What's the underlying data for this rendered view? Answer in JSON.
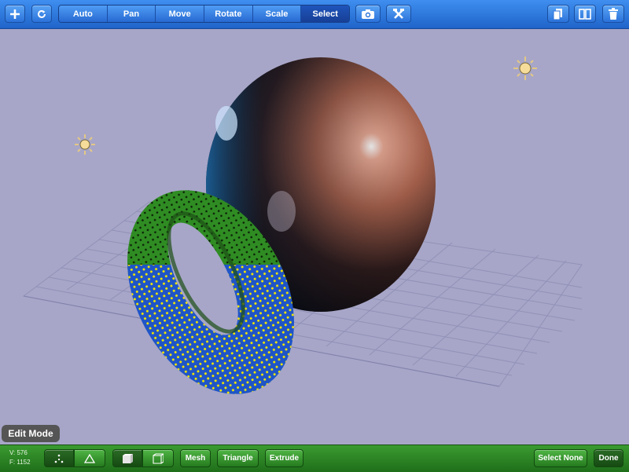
{
  "toolbar": {
    "modes": [
      "Auto",
      "Pan",
      "Move",
      "Rotate",
      "Scale",
      "Select"
    ],
    "active_mode": "Select",
    "icons": [
      "plus-icon",
      "refresh-icon",
      "camera-icon",
      "tools-icon",
      "copy-icon",
      "split-icon",
      "trash-icon"
    ]
  },
  "viewport": {
    "mode_label": "Edit Mode",
    "objects": [
      "sphere",
      "torus"
    ],
    "lights": 2
  },
  "bottombar": {
    "vertex_count": "V: 576",
    "face_count": "F: 1152",
    "mesh_label": "Mesh",
    "triangle_label": "Triangle",
    "extrude_label": "Extrude",
    "select_none_label": "Select None",
    "done_label": "Done"
  },
  "colors": {
    "toolbar": "#2a72da",
    "bottombar": "#2f8a27",
    "background": "#a7a6c8",
    "torus_top": "#2e8b1e",
    "torus_bottom": "#1f4fc0",
    "vertex_selected": "#f2e600"
  }
}
